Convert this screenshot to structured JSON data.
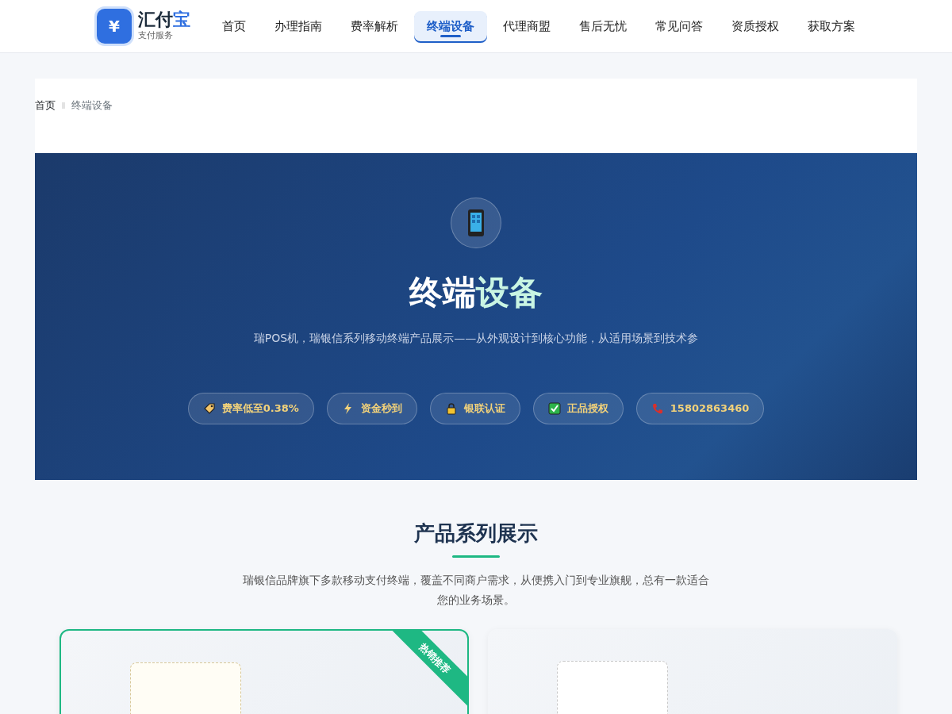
{
  "brand": {
    "name_main": "汇付",
    "name_accent": "宝",
    "tagline": "支付服务",
    "logo_glyph": "¥"
  },
  "nav": [
    {
      "label": "首页",
      "selected": false
    },
    {
      "label": "办理指南",
      "selected": false
    },
    {
      "label": "费率解析",
      "selected": false
    },
    {
      "label": "终端设备",
      "selected": true
    },
    {
      "label": "代理商盟",
      "selected": false
    },
    {
      "label": "售后无忧",
      "selected": false
    },
    {
      "label": "常见问答",
      "selected": false
    },
    {
      "label": "资质授权",
      "selected": false
    },
    {
      "label": "获取方案",
      "selected": false
    }
  ],
  "breadcrumb": [
    "首页",
    "终端设备"
  ],
  "hero": {
    "title_main": "终端",
    "title_accent": "设备",
    "subtitle": "瑞POS机，瑞银信系列移动终端产品展示——从外观设计到核心功能，从适用场景到技术参",
    "badges": [
      {
        "kind": "tag",
        "label": "费率低至0.38%"
      },
      {
        "kind": "bolt",
        "label": "资金秒到"
      },
      {
        "kind": "lock",
        "label": "银联认证"
      },
      {
        "kind": "check",
        "label": "正品授权"
      },
      {
        "kind": "phone",
        "label": "15802863460"
      }
    ]
  },
  "section": {
    "title": "产品系列展示",
    "description": "瑞银信品牌旗下多款移动支付终端，覆盖不同商户需求，从便携入门到专业旗舰，总有一款适合您的业务场景。"
  },
  "products": [
    {
      "featured": true,
      "ribbon": "热销推荐"
    },
    {
      "featured": false
    }
  ]
}
